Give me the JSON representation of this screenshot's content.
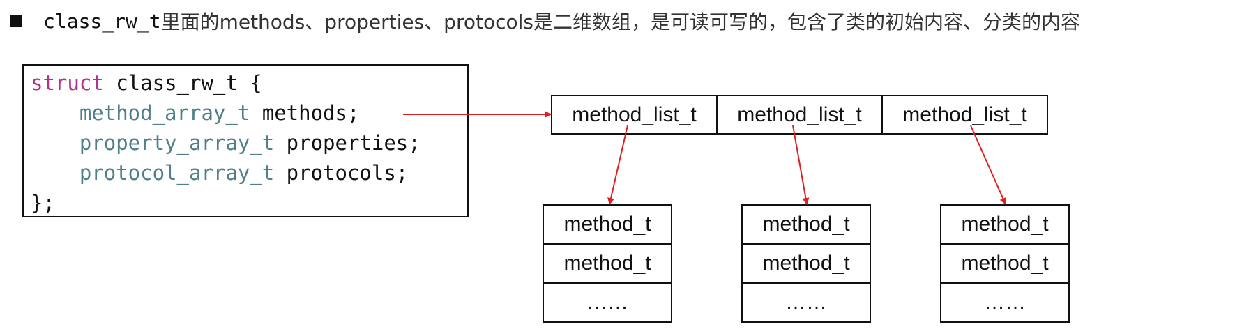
{
  "header": {
    "code": "class_rw_t",
    "desc": "里面的methods、properties、protocols是二维数组，是可读可写的，包含了类的初始内容、分类的内容"
  },
  "code": {
    "line1_kw": "struct",
    "line1_rest": " class_rw_t {",
    "lines": [
      {
        "type": "method_array_t",
        "name": " methods;"
      },
      {
        "type": "property_array_t",
        "name": " properties;"
      },
      {
        "type": "protocol_array_t",
        "name": " protocols;"
      }
    ],
    "close": "};"
  },
  "method_lists": [
    "method_list_t",
    "method_list_t",
    "method_list_t"
  ],
  "stacks": [
    [
      "method_t",
      "method_t",
      "……"
    ],
    [
      "method_t",
      "method_t",
      "……"
    ],
    [
      "method_t",
      "method_t",
      "……"
    ]
  ],
  "colors": {
    "arrow": "#e02020",
    "keyword": "#b0308f",
    "type": "#4f7f8a"
  }
}
